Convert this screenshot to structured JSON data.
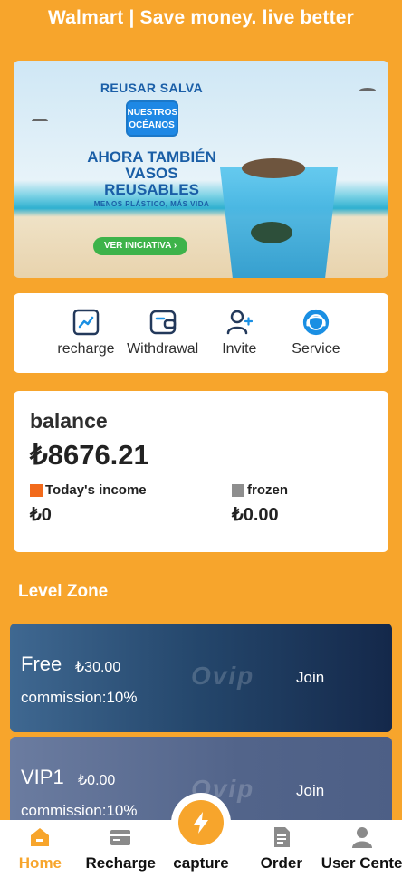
{
  "header": {
    "title": "Walmart | Save money. live better"
  },
  "banner": {
    "eyebrow": "REUSAR SALVA",
    "badge_line1": "NUESTROS",
    "badge_line2": "OCÉANOS",
    "headline_line1": "AHORA TAMBIÉN",
    "headline_line2": "VASOS REUSABLES",
    "subline": "MENOS PLÁSTICO, MÁS VIDA",
    "cta": "VER INICIATIVA ›"
  },
  "quick_actions": {
    "items": [
      {
        "label": "recharge",
        "icon": "chart-trend-icon"
      },
      {
        "label": "Withdrawal",
        "icon": "wallet-icon"
      },
      {
        "label": "Invite",
        "icon": "add-user-icon"
      },
      {
        "label": "Service",
        "icon": "support-icon"
      }
    ]
  },
  "balance": {
    "title": "balance",
    "amount": "₺8676.21",
    "today_income_label": "Today's income",
    "today_income_value": "₺0",
    "frozen_label": "frozen",
    "frozen_value": "₺0.00"
  },
  "level_zone": {
    "title": "Level Zone",
    "levels": [
      {
        "name": "Free",
        "price": "₺30.00",
        "commission": "commission:10%",
        "join": "Join",
        "watermark": "Ovip"
      },
      {
        "name": "VIP1",
        "price": "₺0.00",
        "commission": "commission:10%",
        "join": "Join",
        "watermark": "Ovip"
      }
    ]
  },
  "bottom_nav": {
    "items": [
      {
        "label": "Home",
        "icon": "home-icon",
        "active": true
      },
      {
        "label": "Recharge",
        "icon": "card-icon",
        "active": false
      },
      {
        "label": "capture",
        "icon": "lightning-icon",
        "active": false
      },
      {
        "label": "Order",
        "icon": "document-icon",
        "active": false
      },
      {
        "label": "User Cente",
        "icon": "user-icon",
        "active": false
      }
    ]
  },
  "colors": {
    "background": "#f7a52c",
    "card": "#ffffff",
    "income_square": "#f26a1b",
    "frozen_square": "#8e8e8e",
    "accent_blue": "#1a8fe3",
    "nav_active": "#f7a52c"
  }
}
